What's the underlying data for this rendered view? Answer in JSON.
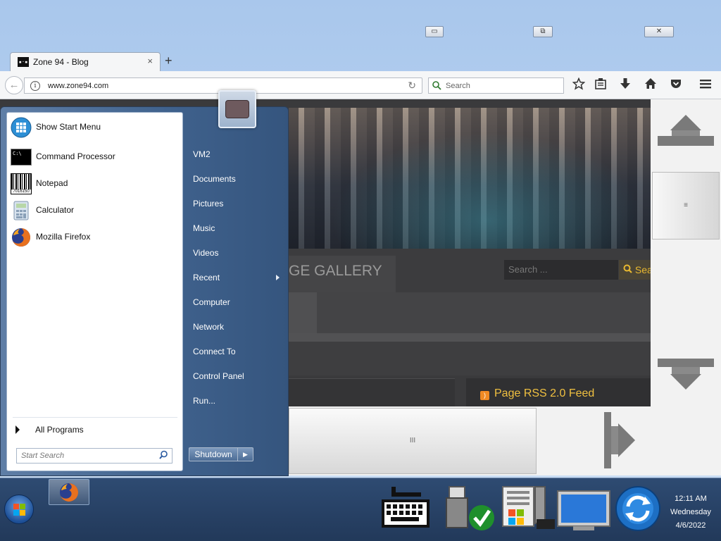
{
  "window": {
    "minimize_glyph": "▭",
    "maximize_glyph": "⧉",
    "close_glyph": "✕"
  },
  "tab": {
    "title": "Zone 94 - Blog",
    "favicon_text": "▪·▪",
    "close_glyph": "×",
    "new_tab_glyph": "+"
  },
  "navbar": {
    "back_glyph": "←",
    "info_glyph": "i",
    "url": "www.zone94.com",
    "reload_glyph": "↻",
    "search_placeholder": "Search",
    "icons": [
      "star-icon",
      "reading-list-icon",
      "download-icon",
      "home-icon",
      "pocket-icon",
      "menu-icon"
    ]
  },
  "page": {
    "gallery_title": "GE GALLERY",
    "search_placeholder": "Search ...",
    "search_button": "Sea",
    "rss_label": "Page RSS 2.0 Feed"
  },
  "scrollbars": {
    "v_grip": "≡",
    "h_grip": "III"
  },
  "start_menu": {
    "programs": [
      {
        "label": "Show Start Menu",
        "icon": "start-menu-icon"
      },
      {
        "label": "Command Processor",
        "icon": "cmd-icon"
      },
      {
        "label": "Notepad",
        "icon": "notepad-icon"
      },
      {
        "label": "Calculator",
        "icon": "calculator-icon"
      },
      {
        "label": "Mozilla Firefox",
        "icon": "firefox-icon"
      }
    ],
    "cmd_icon_text": "C:\\",
    "notepad_icon_text": "7016150",
    "all_programs": "All Programs",
    "search_placeholder": "Start Search",
    "places": [
      "VM2",
      "Documents",
      "Pictures",
      "Music",
      "Videos",
      "Recent",
      "Computer",
      "Network",
      "Connect To",
      "Control Panel",
      "Run..."
    ],
    "shutdown": "Shutdown",
    "shutdown_arrow": "▶"
  },
  "taskbar": {
    "pinned": [
      "firefox-icon"
    ],
    "tray_icons": [
      "keyboard-icon",
      "usb-safe-remove-icon",
      "windows-update-icon",
      "display-icon",
      "network-sync-icon"
    ],
    "time": "12:11 AM",
    "day": "Wednesday",
    "date": "4/6/2022"
  },
  "colors": {
    "rss_text": "#f0c040",
    "search_button_text": "#e8b830",
    "start_menu_blue": "#3f618c",
    "taskbar": "#2e4b72"
  }
}
